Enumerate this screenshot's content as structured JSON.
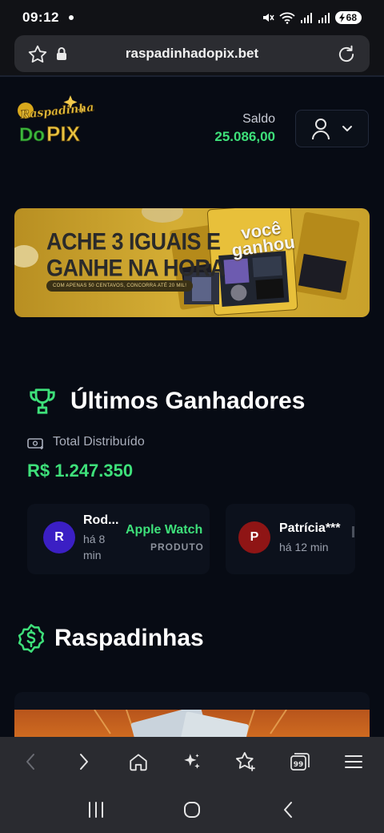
{
  "status_bar": {
    "time": "09:12",
    "battery": "68"
  },
  "browser": {
    "url": "raspadinhadopix.bet"
  },
  "header": {
    "logo": {
      "line1": "Raspadinhas",
      "line2": "Do",
      "line3": "PIX"
    },
    "balance_label": "Saldo",
    "balance_value": "25.086,00"
  },
  "banner": {
    "title_line1": "ACHE 3 IGUAIS E",
    "title_line2": "GANHE NA HORA",
    "subtitle": "COM APENAS 50 CENTAVOS, CONCORRA ATÉ 20 MIL!",
    "card_text_line1": "você",
    "card_text_line2": "ganhou"
  },
  "winners": {
    "title": "Últimos Ganhadores",
    "total_label": "Total Distribuído",
    "total_value": "R$ 1.247.350",
    "items": [
      {
        "initial": "R",
        "name": "Rod...",
        "time": "há 8 min",
        "prize": "Apple Watch",
        "type": "PRODUTO",
        "avatar_color": "#3b1fc4"
      },
      {
        "initial": "P",
        "name": "Patrícia***",
        "time": "há 12 min",
        "prize": "",
        "type": "",
        "avatar_color": "#8f1515"
      }
    ]
  },
  "scratch": {
    "title": "Raspadinhas"
  },
  "colors": {
    "accent_green": "#3ee07a",
    "page_bg": "#070b14"
  }
}
